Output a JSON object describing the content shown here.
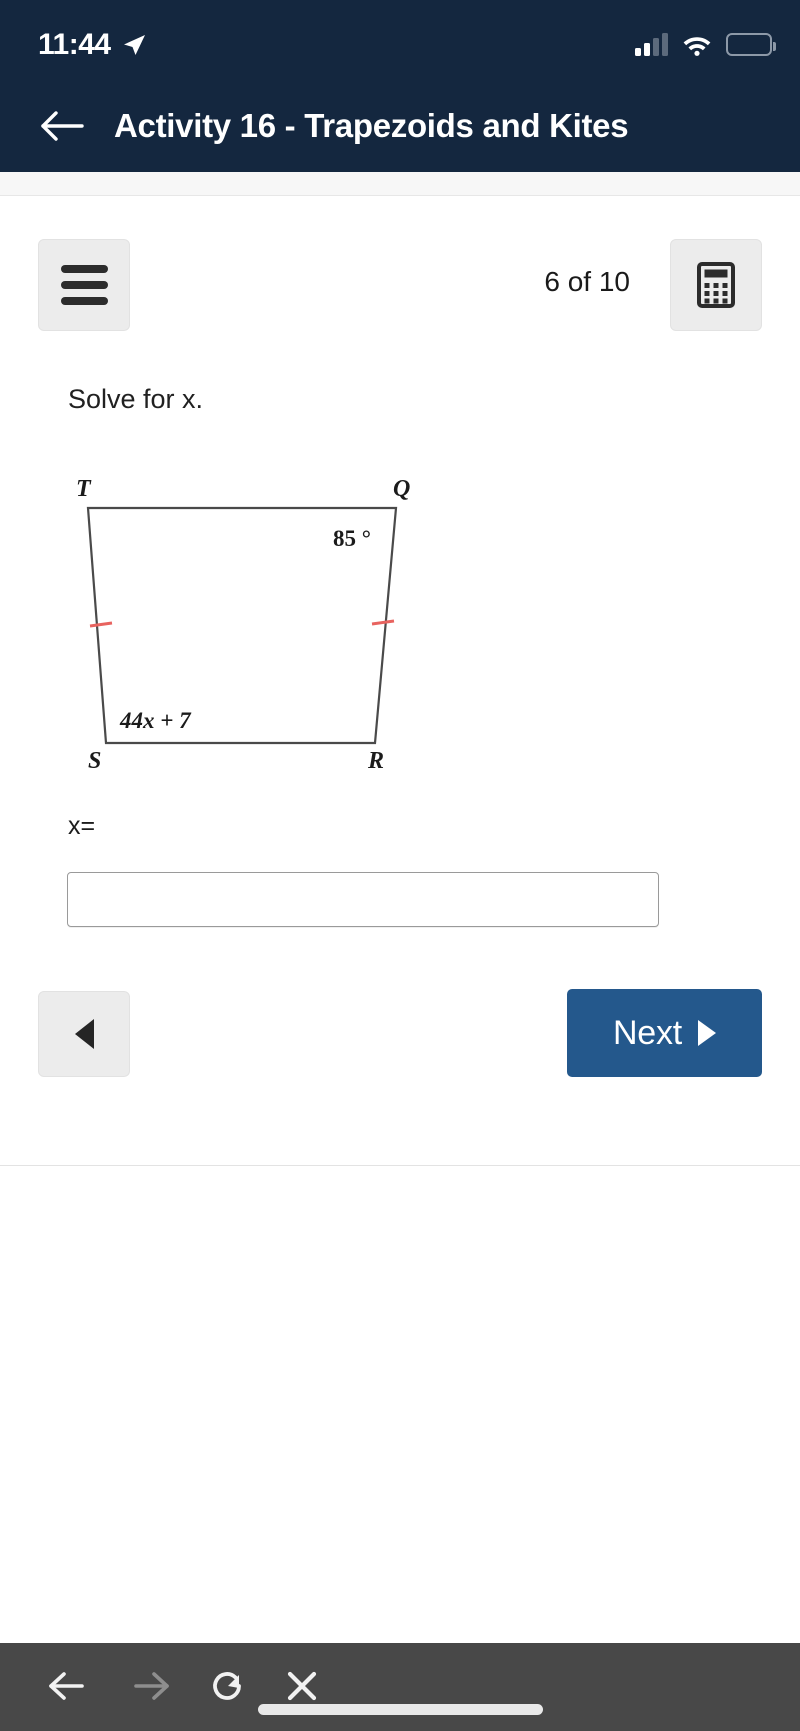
{
  "status_bar": {
    "time": "11:44",
    "location_icon": "location-arrow-icon",
    "signal_icon": "cellular-signal-icon",
    "wifi_icon": "wifi-icon",
    "battery_icon": "battery-icon",
    "battery_color": "#f4d03f"
  },
  "header": {
    "back_icon": "back-arrow-icon",
    "title": "Activity 16 - Trapezoids and Kites",
    "background_color": "#14273f"
  },
  "toolbar": {
    "menu_icon": "hamburger-menu-icon",
    "progress": "6 of 10",
    "calculator_icon": "calculator-icon"
  },
  "question": {
    "prompt": "Solve for x.",
    "answer_label": "x=",
    "answer_value": "",
    "answer_placeholder": ""
  },
  "figure": {
    "type": "trapezoid",
    "vertices": [
      "T",
      "Q",
      "R",
      "S"
    ],
    "vertex_labels": {
      "top_left": "T",
      "top_right": "Q",
      "bottom_right": "R",
      "bottom_left": "S"
    },
    "angle_label": "85 °",
    "expression_label": "44x + 7",
    "tick_mark_color": "#e8635f",
    "stroke_color": "#4a4a4a"
  },
  "navigation": {
    "prev_icon": "triangle-left-icon",
    "next_label": "Next",
    "next_icon": "triangle-right-icon",
    "next_color": "#24588c"
  },
  "browser_bar": {
    "background_color": "#484848",
    "back_icon": "arrow-left-icon",
    "forward_icon": "arrow-right-icon",
    "reload_icon": "reload-icon",
    "stop_icon": "close-x-icon",
    "home_indicator": "home-indicator"
  }
}
